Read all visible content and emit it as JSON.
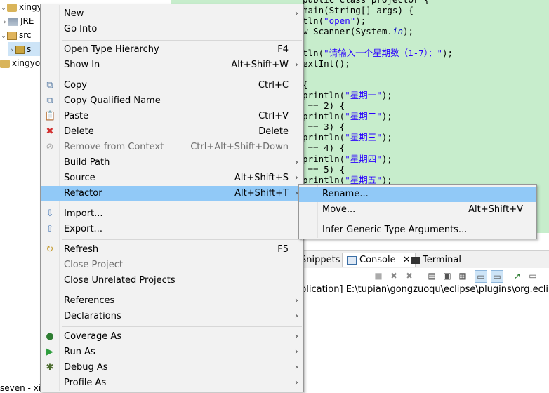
{
  "tree": {
    "rows": [
      {
        "label": "xingyo",
        "toggle": "⌄"
      },
      {
        "label": "JRE",
        "toggle": "›"
      },
      {
        "label": "src",
        "toggle": "⌄"
      },
      {
        "label": "s",
        "toggle": "›"
      },
      {
        "label": "xingyo",
        "toggle": ""
      }
    ],
    "bottom_label": "seven - xi"
  },
  "editor": {
    "lines": [
      {
        "parts": [
          [
            "",
            "public class projector {"
          ]
        ]
      },
      {
        "parts": [
          [
            "",
            "main(String[] args) {"
          ]
        ]
      },
      {
        "parts": [
          [
            "",
            "tln("
          ],
          [
            "str",
            "\"open\""
          ],
          [
            "",
            ");"
          ]
        ]
      },
      {
        "parts": [
          [
            "",
            "w Scanner(System."
          ],
          [
            "fld",
            "in"
          ],
          [
            "",
            ");"
          ]
        ]
      },
      {
        "parts": [
          [
            "",
            ""
          ]
        ]
      },
      {
        "parts": [
          [
            "",
            "tln("
          ],
          [
            "str",
            "\"请输入一个星期数（1-7）：\""
          ],
          [
            "",
            ");"
          ]
        ]
      },
      {
        "parts": [
          [
            "",
            "extInt();"
          ]
        ]
      },
      {
        "parts": [
          [
            "",
            ""
          ]
        ]
      },
      {
        "parts": [
          [
            "",
            "{"
          ]
        ]
      },
      {
        "parts": [
          [
            "",
            "println("
          ],
          [
            "str",
            "\"星期一\""
          ],
          [
            "",
            ");"
          ]
        ]
      },
      {
        "parts": [
          [
            "",
            " == 2) {"
          ]
        ]
      },
      {
        "parts": [
          [
            "",
            "println("
          ],
          [
            "str",
            "\"星期二\""
          ],
          [
            "",
            ");"
          ]
        ]
      },
      {
        "parts": [
          [
            "",
            " == 3) {"
          ]
        ]
      },
      {
        "parts": [
          [
            "",
            "println("
          ],
          [
            "str",
            "\"星期三\""
          ],
          [
            "",
            ");"
          ]
        ]
      },
      {
        "parts": [
          [
            "",
            " == 4) {"
          ]
        ]
      },
      {
        "parts": [
          [
            "",
            "println("
          ],
          [
            "str",
            "\"星期四\""
          ],
          [
            "",
            ");"
          ]
        ]
      },
      {
        "parts": [
          [
            "",
            " == 5) {"
          ]
        ]
      },
      {
        "parts": [
          [
            "",
            "println("
          ],
          [
            "str",
            "\"星期五\""
          ],
          [
            "",
            ");"
          ]
        ]
      }
    ]
  },
  "panel": {
    "tabs": {
      "snippets": "Snippets",
      "console": "Console",
      "terminal": "Terminal"
    },
    "console_line": "plication] E:\\tupian\\gongzuoqu\\eclipse\\plugins\\org.eclipse.ju"
  },
  "context_menu": {
    "items": {
      "new": {
        "label": "New",
        "shortcut": ""
      },
      "go_into": {
        "label": "Go Into",
        "shortcut": ""
      },
      "open_type_hierarchy": {
        "label": "Open Type Hierarchy",
        "shortcut": "F4"
      },
      "show_in": {
        "label": "Show In",
        "shortcut": "Alt+Shift+W"
      },
      "copy": {
        "label": "Copy",
        "shortcut": "Ctrl+C"
      },
      "copy_qualified": {
        "label": "Copy Qualified Name",
        "shortcut": ""
      },
      "paste": {
        "label": "Paste",
        "shortcut": "Ctrl+V"
      },
      "delete": {
        "label": "Delete",
        "shortcut": "Delete"
      },
      "remove_context": {
        "label": "Remove from Context",
        "shortcut": "Ctrl+Alt+Shift+Down"
      },
      "build_path": {
        "label": "Build Path",
        "shortcut": ""
      },
      "source": {
        "label": "Source",
        "shortcut": "Alt+Shift+S"
      },
      "refactor": {
        "label": "Refactor",
        "shortcut": "Alt+Shift+T"
      },
      "import": {
        "label": "Import...",
        "shortcut": ""
      },
      "export": {
        "label": "Export...",
        "shortcut": ""
      },
      "refresh": {
        "label": "Refresh",
        "shortcut": "F5"
      },
      "close_project": {
        "label": "Close Project",
        "shortcut": ""
      },
      "close_unrelated": {
        "label": "Close Unrelated Projects",
        "shortcut": ""
      },
      "references": {
        "label": "References",
        "shortcut": ""
      },
      "declarations": {
        "label": "Declarations",
        "shortcut": ""
      },
      "coverage_as": {
        "label": "Coverage As",
        "shortcut": ""
      },
      "run_as": {
        "label": "Run As",
        "shortcut": ""
      },
      "debug_as": {
        "label": "Debug As",
        "shortcut": ""
      },
      "profile_as": {
        "label": "Profile As",
        "shortcut": ""
      }
    }
  },
  "submenu": {
    "rename": {
      "label": "Rename...",
      "shortcut": ""
    },
    "move": {
      "label": "Move...",
      "shortcut": "Alt+Shift+V"
    },
    "infer_generic": {
      "label": "Infer Generic Type Arguments...",
      "shortcut": ""
    }
  },
  "glyphs": {
    "arrow": "›"
  },
  "colors": {
    "highlight": "#91c9f7",
    "editor_bg": "#c7edcc",
    "menu_bg": "#f2f2f2"
  }
}
